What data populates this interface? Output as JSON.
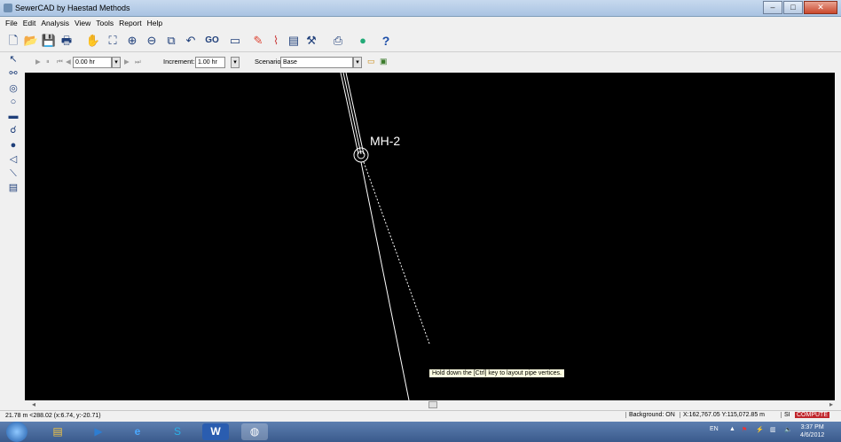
{
  "window": {
    "title": "SewerCAD by Haestad Methods",
    "buttons": {
      "minimize": "–",
      "maximize": "□",
      "close": "✕"
    }
  },
  "menu": [
    "File",
    "Edit",
    "Analysis",
    "View",
    "Tools",
    "Report",
    "Help"
  ],
  "toolbar": {
    "icons": [
      "new-icon",
      "open-icon",
      "save-icon",
      "print-icon",
      "pan-icon",
      "zoom-extents-icon",
      "zoom-in-icon",
      "zoom-out-icon",
      "zoom-window-icon",
      "zoom-previous-icon",
      "go-icon",
      "rectangle-icon",
      "color-coding-icon",
      "profile-icon",
      "graph-icon",
      "pipe-icon",
      "report-icon",
      "globe-icon",
      "help-icon"
    ],
    "go_label": "GO",
    "help_label": "?"
  },
  "timebar": {
    "time_value": "0.00 hr",
    "increment_label": "Increment:",
    "increment_value": "1.00 hr",
    "scenario_label": "Scenario:",
    "scenario_value": "Base"
  },
  "canvas": {
    "node_label": "MH-2",
    "tooltip": "Hold down the [Ctrl] key to layout pipe vertices."
  },
  "status": {
    "left": "21.78 m <288.02 (x:6.74, y:-20.71)",
    "background": "Background: ON",
    "coords": "X:162,767.05  Y:115,072.85 m",
    "units": "SI",
    "compute": "COMPUTE"
  },
  "taskbar": {
    "tray_lang": "EN",
    "time": "3:37 PM",
    "date": "4/6/2012",
    "word_label": "W"
  },
  "colors": {
    "canvas_bg": "#000000",
    "pipe_line": "#ffffff",
    "compute_bg": "#c0262c"
  }
}
